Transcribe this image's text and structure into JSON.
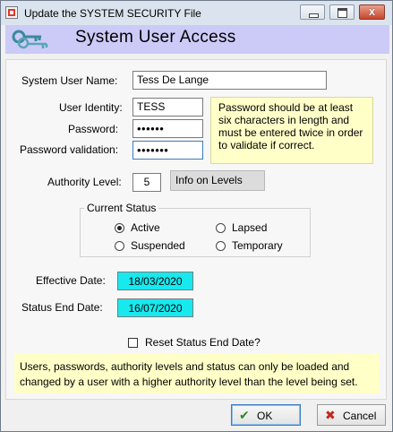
{
  "window": {
    "title": "Update the SYSTEM SECURITY File",
    "close_glyph": "x"
  },
  "header": {
    "title": "System User Access"
  },
  "form": {
    "user_name_label": "System User Name:",
    "user_name_value": "Tess De Lange",
    "user_identity_label": "User Identity:",
    "user_identity_value": "TESS",
    "password_label": "Password:",
    "password_value": "••••••",
    "password_validation_label": "Password validation:",
    "password_validation_value": "•••••••",
    "password_note": "Password should be at least six characters in length and must be entered twice in order to validate if correct.",
    "authority_level_label": "Authority Level:",
    "authority_level_value": "5",
    "info_levels_button": "Info on Levels"
  },
  "current_status": {
    "legend": "Current Status",
    "options": [
      {
        "label": "Active",
        "selected": true
      },
      {
        "label": "Lapsed",
        "selected": false
      },
      {
        "label": "Suspended",
        "selected": false
      },
      {
        "label": "Temporary",
        "selected": false
      }
    ]
  },
  "dates": {
    "effective_label": "Effective Date:",
    "effective_value": "18/03/2020",
    "status_end_label": "Status End Date:",
    "status_end_value": "16/07/2020",
    "field_color": "#17e9ef"
  },
  "reset_checkbox": {
    "label": "Reset Status End Date?",
    "checked": false
  },
  "footer_note": "Users, passwords, authority levels and status can only be loaded and changed by a user with a higher authority level than the level being set.",
  "buttons": {
    "ok_label": "OK",
    "cancel_label": "Cancel"
  },
  "icons": [
    "app-icon",
    "keys-icon",
    "minimize-icon",
    "maximize-icon",
    "close-icon",
    "checkmark-icon",
    "cross-icon"
  ],
  "colors": {
    "header_bg": "#cccaf7",
    "note_bg": "#ffffc8",
    "title_bar": "#dbe4ee"
  }
}
